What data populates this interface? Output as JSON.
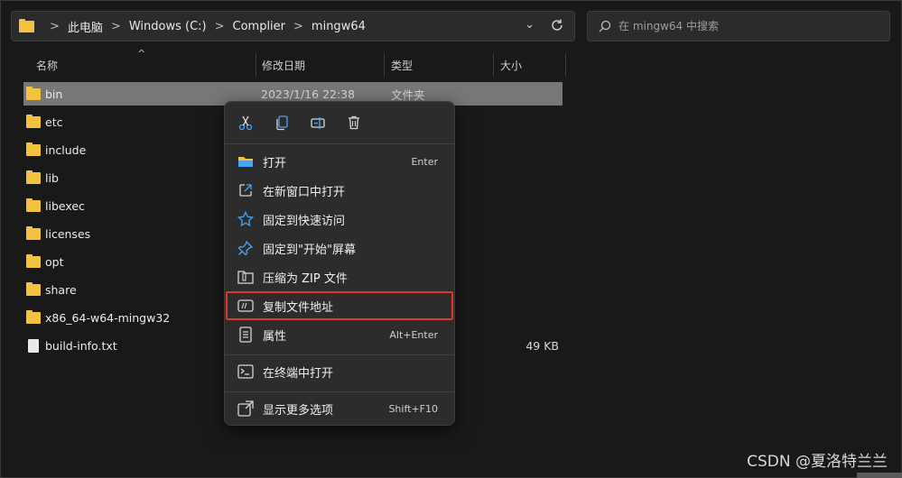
{
  "address_bar": {
    "crumbs": [
      "此电脑",
      "Windows (C:)",
      "Complier",
      "mingw64"
    ],
    "separator": ">",
    "dropdown": "⌄"
  },
  "search": {
    "placeholder": "在 mingw64 中搜索"
  },
  "columns": {
    "name": "名称",
    "date": "修改日期",
    "type": "类型",
    "size": "大小",
    "sort": "^"
  },
  "files": [
    {
      "name": "bin",
      "date": "2023/1/16 22:38",
      "type": "文件夹",
      "size": "",
      "kind": "folder",
      "selected": true
    },
    {
      "name": "etc",
      "date": "",
      "type": "",
      "size": "",
      "kind": "folder",
      "selected": false
    },
    {
      "name": "include",
      "date": "",
      "type": "",
      "size": "",
      "kind": "folder",
      "selected": false
    },
    {
      "name": "lib",
      "date": "",
      "type": "",
      "size": "",
      "kind": "folder",
      "selected": false
    },
    {
      "name": "libexec",
      "date": "",
      "type": "",
      "size": "",
      "kind": "folder",
      "selected": false
    },
    {
      "name": "licenses",
      "date": "",
      "type": "",
      "size": "",
      "kind": "folder",
      "selected": false
    },
    {
      "name": "opt",
      "date": "",
      "type": "",
      "size": "",
      "kind": "folder",
      "selected": false
    },
    {
      "name": "share",
      "date": "",
      "type": "",
      "size": "",
      "kind": "folder",
      "selected": false
    },
    {
      "name": "x86_64-w64-mingw32",
      "date": "",
      "type": "",
      "size": "",
      "kind": "folder",
      "selected": false
    },
    {
      "name": "build-info.txt",
      "date": "",
      "type": "",
      "size": "49 KB",
      "kind": "txt",
      "selected": false
    }
  ],
  "context_menu": {
    "quick_actions": [
      "cut-icon",
      "copy-icon",
      "rename-icon",
      "delete-icon"
    ],
    "items": [
      {
        "label": "打开",
        "shortcut": "Enter",
        "icon": "folder-open-icon"
      },
      {
        "label": "在新窗口中打开",
        "shortcut": "",
        "icon": "open-new-window-icon"
      },
      {
        "label": "固定到快速访问",
        "shortcut": "",
        "icon": "star-icon"
      },
      {
        "label": "固定到\"开始\"屏幕",
        "shortcut": "",
        "icon": "pin-icon"
      },
      {
        "label": "压缩为 ZIP 文件",
        "shortcut": "",
        "icon": "zip-icon"
      },
      {
        "label": "复制文件地址",
        "shortcut": "",
        "icon": "copy-path-icon"
      },
      {
        "label": "属性",
        "shortcut": "Alt+Enter",
        "icon": "properties-icon"
      },
      {
        "label": "在终端中打开",
        "shortcut": "",
        "icon": "terminal-icon"
      },
      {
        "label": "显示更多选项",
        "shortcut": "Shift+F10",
        "icon": "more-options-icon"
      }
    ]
  },
  "watermark": "CSDN @夏洛特兰兰",
  "colors": {
    "background": "#191919",
    "selection": "#777777",
    "folder": "#f3c23f",
    "accent": "#4aa3f0",
    "highlight": "#d93a2b"
  }
}
